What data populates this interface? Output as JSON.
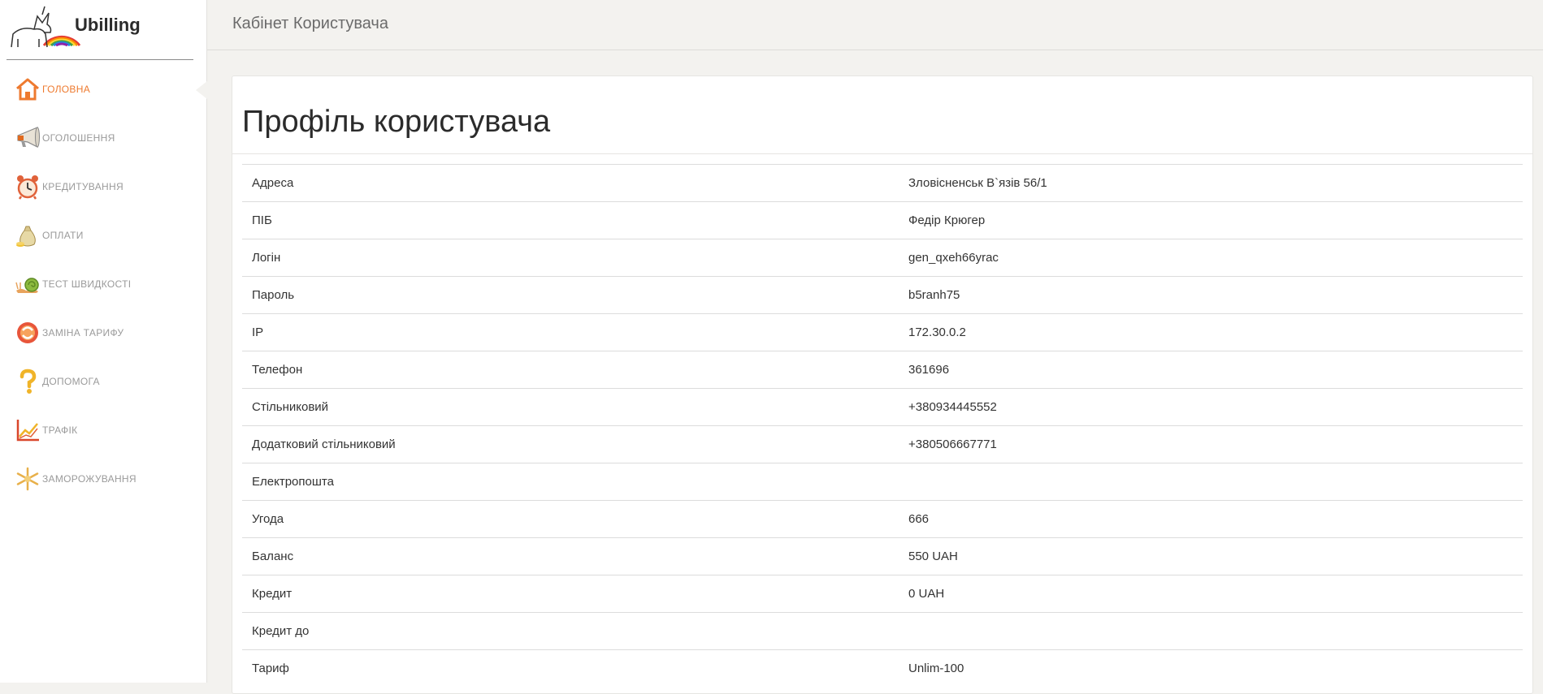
{
  "brand": {
    "name": "Ubilling"
  },
  "header": {
    "title": "Кабінет Користувача"
  },
  "sidebar": {
    "items": [
      {
        "label": "Головна",
        "icon": "home-icon",
        "active": true
      },
      {
        "label": "Оголошення",
        "icon": "megaphone-icon"
      },
      {
        "label": "Кредитування",
        "icon": "alarm-clock-icon"
      },
      {
        "label": "Оплати",
        "icon": "money-bag-icon"
      },
      {
        "label": "Тест швидкості",
        "icon": "snail-icon"
      },
      {
        "label": "Заміна тарифу",
        "icon": "swap-tariff-icon"
      },
      {
        "label": "Допомога",
        "icon": "question-icon"
      },
      {
        "label": "Трафік",
        "icon": "chart-icon"
      },
      {
        "label": "Заморожування",
        "icon": "snowflake-icon"
      }
    ]
  },
  "profile": {
    "title": "Профіль користувача",
    "rows": [
      {
        "label": "Адреса",
        "value": "Зловісненськ В`язів 56/1"
      },
      {
        "label": "ПІБ",
        "value": "Федір Крюгер"
      },
      {
        "label": "Логін",
        "value": "gen_qxeh66yrac"
      },
      {
        "label": "Пароль",
        "value": "b5ranh75"
      },
      {
        "label": "IP",
        "value": "172.30.0.2"
      },
      {
        "label": "Телефон",
        "value": "361696"
      },
      {
        "label": "Стільниковий",
        "value": "+380934445552"
      },
      {
        "label": "Додатковий стільниковий",
        "value": "+380506667771"
      },
      {
        "label": "Електропошта",
        "value": ""
      },
      {
        "label": "Угода",
        "value": "666"
      },
      {
        "label": "Баланс",
        "value": "550 UAH"
      },
      {
        "label": "Кредит",
        "value": "0 UAH"
      },
      {
        "label": "Кредит до",
        "value": ""
      },
      {
        "label": "Тариф",
        "value": "Unlim-100"
      }
    ]
  },
  "colors": {
    "accent": "#ee7a2f",
    "background": "#f3f2ef"
  }
}
